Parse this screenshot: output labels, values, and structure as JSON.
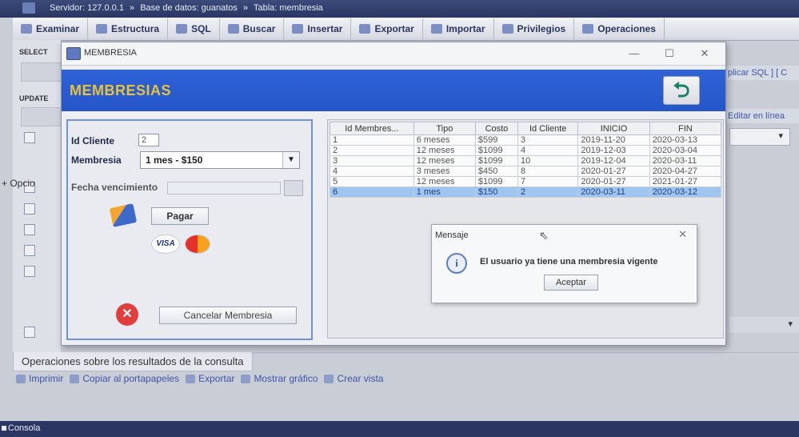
{
  "browser": {
    "breadcrumb": [
      "Servidor: 127.0.0.1",
      "»",
      "Base de datos: guanatos",
      "»",
      "Tabla: membresia"
    ]
  },
  "pma_tabs": [
    {
      "label": "Examinar",
      "icon": "table-icon"
    },
    {
      "label": "Estructura",
      "icon": "structure-icon"
    },
    {
      "label": "SQL",
      "icon": "sql-icon"
    },
    {
      "label": "Buscar",
      "icon": "search-icon"
    },
    {
      "label": "Insertar",
      "icon": "insert-icon"
    },
    {
      "label": "Exportar",
      "icon": "export-icon"
    },
    {
      "label": "Importar",
      "icon": "import-icon"
    },
    {
      "label": "Privilegios",
      "icon": "privileges-icon"
    },
    {
      "label": "Operaciones",
      "icon": "wrench-icon"
    }
  ],
  "side": {
    "select_label": "SELECT",
    "update_label": "UPDATE",
    "opcion_label": "+ Opcio"
  },
  "right_links": {
    "sql_link": "plicar SQL ] [ C",
    "edit_link": "Editar en línea"
  },
  "operations": {
    "title": "Operaciones sobre los resultados de la consulta",
    "links": [
      {
        "label": "Imprimir",
        "icon": "print-icon"
      },
      {
        "label": "Copiar al portapapeles",
        "icon": "copy-icon"
      },
      {
        "label": "Exportar",
        "icon": "export-icon"
      },
      {
        "label": "Mostrar gráfico",
        "icon": "chart-icon"
      },
      {
        "label": "Crear vista",
        "icon": "view-icon"
      }
    ]
  },
  "console": {
    "label": "Consola"
  },
  "window": {
    "title": "MEMBRESIA",
    "header": "MEMBRESIAS",
    "controls": {
      "minimize": "—",
      "maximize": "☐",
      "close": "✕"
    }
  },
  "form": {
    "id_cliente_label": "Id Cliente",
    "id_cliente_value": "2",
    "membresia_label": "Membresia",
    "membresia_selected": "1 mes - $150",
    "fecha_label": "Fecha vencimiento",
    "pagar_label": "Pagar",
    "visa_label": "VISA",
    "cancelar_label": "Cancelar Membresia"
  },
  "table": {
    "columns": [
      "Id Membres...",
      "Tipo",
      "Costo",
      "Id Cliente",
      "INICIO",
      "FIN"
    ],
    "rows": [
      [
        "1",
        "6 meses",
        "$599",
        "3",
        "2019-11-20",
        "2020-03-13"
      ],
      [
        "2",
        "12 meses",
        "$1099",
        "4",
        "2019-12-03",
        "2020-03-04"
      ],
      [
        "3",
        "12 meses",
        "$1099",
        "10",
        "2019-12-04",
        "2020-03-11"
      ],
      [
        "4",
        "3 meses",
        "$450",
        "8",
        "2020-01-27",
        "2020-04-27"
      ],
      [
        "5",
        "12 meses",
        "$1099",
        "7",
        "2020-01-27",
        "2021-01-27"
      ],
      [
        "6",
        "1 mes",
        "$150",
        "2",
        "2020-03-11",
        "2020-03-12"
      ]
    ],
    "selected_row": 5
  },
  "dialog": {
    "title": "Mensaje",
    "message": "El usuario ya tiene una membresia vigente",
    "button": "Aceptar",
    "close": "✕"
  }
}
